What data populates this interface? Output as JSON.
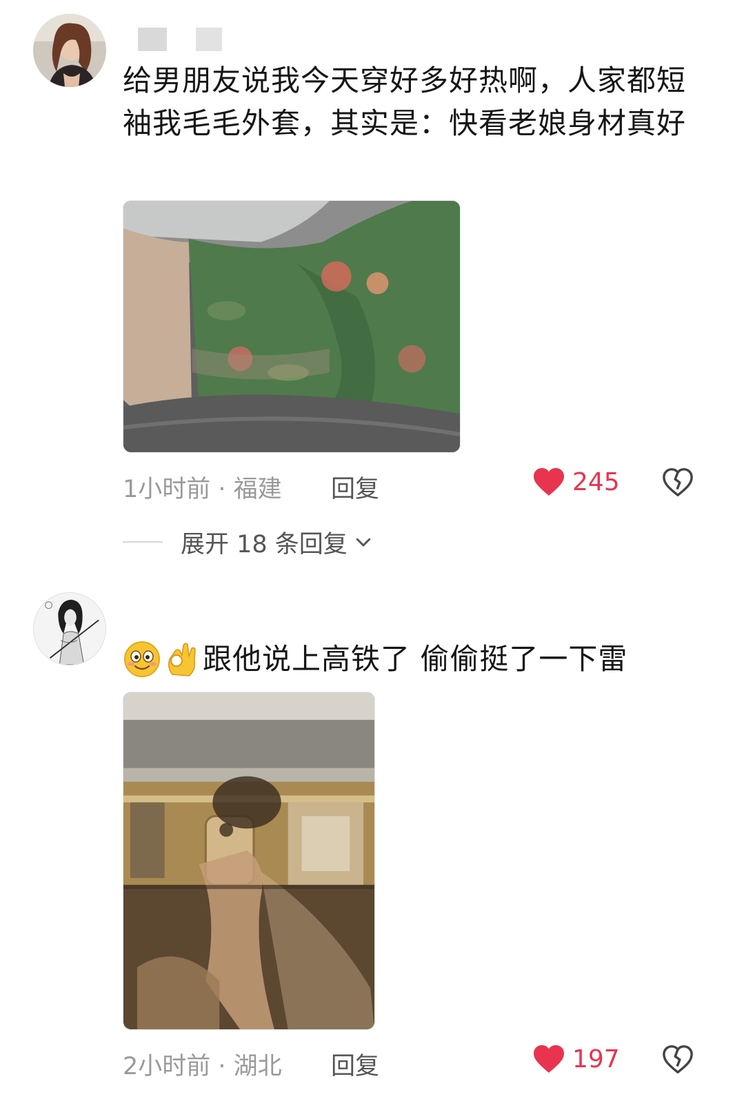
{
  "comments": [
    {
      "text": "给男朋友说我今天穿好多好热啊，人家都短袖我毛毛外套，其实是：快看老娘身材真好",
      "time_location": "1小时前 · 福建",
      "reply_label": "回复",
      "likes": "245",
      "expand_label": "展开 18 条回复"
    },
    {
      "text": "跟他说上高铁了 偷偷挺了一下雷",
      "emoji_icons": [
        "smiling-face-icon",
        "ok-hand-icon"
      ],
      "time_location": "2小时前 · 湖北",
      "reply_label": "回复",
      "likes": "197"
    }
  ],
  "colors": {
    "like_red": "#e8344f",
    "meta_gray": "#9a9a9a",
    "text": "#161616"
  }
}
